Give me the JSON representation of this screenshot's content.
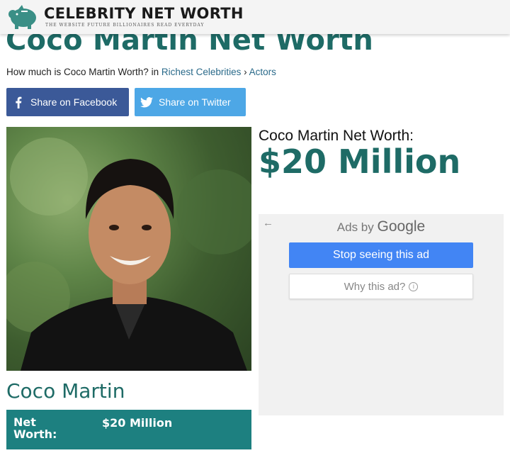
{
  "header": {
    "brand": "CELEBRITY NET WORTH",
    "tagline": "THE WEBSITE FUTURE BILLIONAIRES READ EVERYDAY",
    "logo_icon": "piggy-bank-icon"
  },
  "page": {
    "title": "Coco Martin Net Worth",
    "question": "How much is Coco Martin Worth? in",
    "breadcrumb": [
      "Richest Celebrities",
      "Actors"
    ],
    "breadcrumb_sep": "›"
  },
  "share": {
    "facebook": "Share on Facebook",
    "twitter": "Share on Twitter"
  },
  "headline": {
    "label": "Coco Martin Net Worth:",
    "value": "$20 Million"
  },
  "ad": {
    "back": "←",
    "ads_by": "Ads by",
    "google": "Google",
    "stop": "Stop seeing this ad",
    "why": "Why this ad?"
  },
  "profile": {
    "name": "Coco Martin",
    "row_label": "Net Worth:",
    "row_value": "$20 Million"
  },
  "colors": {
    "accent": "#1e6b66",
    "facebook": "#3b5998",
    "twitter": "#4da7e6",
    "google_blue": "#4285f4",
    "table_bg": "#1d8080"
  }
}
